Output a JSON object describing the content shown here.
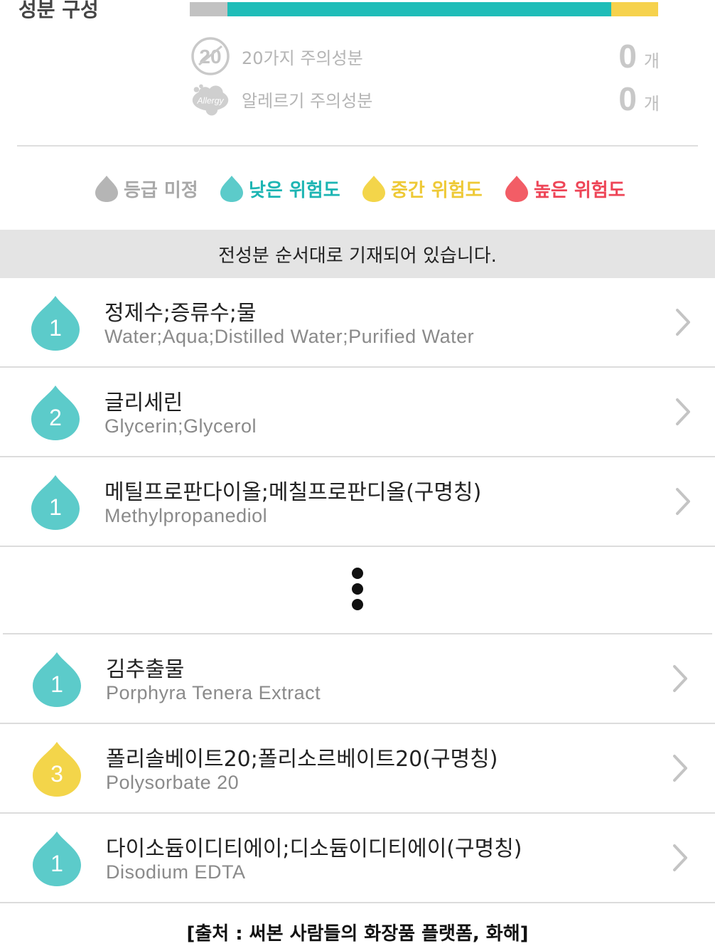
{
  "header": {
    "title": "성분 구성"
  },
  "composition_bar": {
    "segments": [
      {
        "name": "등급 미정",
        "fraction": 0.08,
        "color": "#c2c2c2"
      },
      {
        "name": "낮은 위험도",
        "fraction": 0.82,
        "color": "#1fbdb8"
      },
      {
        "name": "중간 위험도",
        "fraction": 0.1,
        "color": "#f6d24d"
      }
    ]
  },
  "warnings": [
    {
      "icon": "twenty-badge-icon",
      "badge_text": "20",
      "label": "20가지 주의성분",
      "count": "0",
      "unit": "개"
    },
    {
      "icon": "allergy-cloud-icon",
      "badge_text": "Allergy",
      "label": "알레르기 주의성분",
      "count": "0",
      "unit": "개"
    }
  ],
  "legend": [
    {
      "label": "등급 미정",
      "color": "#b5b5b5",
      "text_color": "#a8a8a8"
    },
    {
      "label": "낮은 위험도",
      "color": "#5ccbca",
      "text_color": "#1db5b3"
    },
    {
      "label": "중간 위험도",
      "color": "#f3d54a",
      "text_color": "#eec936"
    },
    {
      "label": "높은 위험도",
      "color": "#f25d66",
      "text_color": "#ee4557"
    }
  ],
  "order_notice": "전성분 순서대로 기재되어 있습니다.",
  "ingredients": [
    {
      "grade": "1",
      "name_ko": "정제수;증류수;물",
      "name_en": "Water;Aqua;Distilled Water;Purified Water",
      "color": "#5ccbca"
    },
    {
      "grade": "2",
      "name_ko": "글리세린",
      "name_en": "Glycerin;Glycerol",
      "color": "#5ccbca"
    },
    {
      "grade": "1",
      "name_ko": "메틸프로판다이올;메칠프로판디올(구명칭)",
      "name_en": "Methylpropanediol",
      "color": "#5ccbca"
    },
    {
      "grade": "1",
      "name_ko": "김추출물",
      "name_en": "Porphyra Tenera Extract",
      "color": "#5ccbca"
    },
    {
      "grade": "3",
      "name_ko": "폴리솔베이트20;폴리소르베이트20(구명칭)",
      "name_en": "Polysorbate 20",
      "color": "#f3d54a"
    },
    {
      "grade": "1",
      "name_ko": "다이소듐이디티에이;디소듐이디티에이(구명칭)",
      "name_en": "Disodium EDTA",
      "color": "#5ccbca"
    }
  ],
  "source": "[출처 : 써본 사람들의 화장품 플랫폼, 화해]"
}
